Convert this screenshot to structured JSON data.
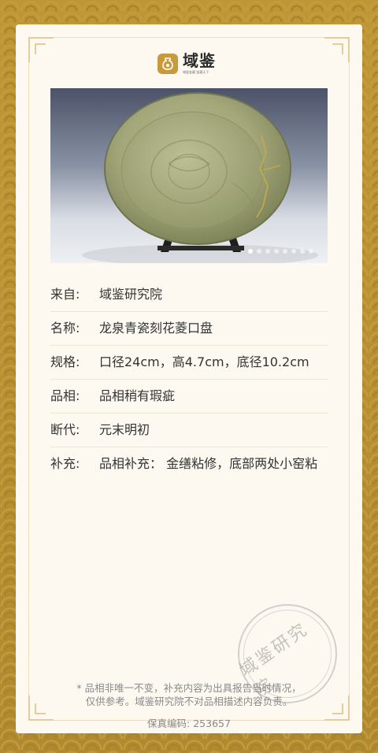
{
  "brand": {
    "name": "域鉴",
    "tagline": "域鉴鉴藏 鉴藏天下"
  },
  "photo": {
    "subject": "celadon-dish",
    "dot_count": 8,
    "active_dot": 0
  },
  "details": [
    {
      "label": "来自:",
      "value": "域鉴研究院"
    },
    {
      "label": "名称:",
      "value": "龙泉青瓷刻花菱口盘"
    },
    {
      "label": "规格:",
      "value": "口径24cm，高4.7cm，底径10.2cm"
    },
    {
      "label": "品相:",
      "value": "品相稍有瑕疵"
    },
    {
      "label": "断代:",
      "value": "元末明初"
    },
    {
      "label": "补充:",
      "value": "品相补充： 金缮粘修，底部两处小窑粘"
    }
  ],
  "stamp": {
    "text": "域鉴研究院"
  },
  "disclaimer": {
    "line1": "* 品相非唯一不变，补充内容为出具报告当时情况，",
    "line2": "仅供参考。域鉴研究院不对品相描述内容负责。"
  },
  "code": {
    "label": "保真编码:",
    "value": "253657"
  },
  "colors": {
    "gold": "#b8902f",
    "card": "#fdf9f1",
    "accent": "#c79a3c"
  }
}
